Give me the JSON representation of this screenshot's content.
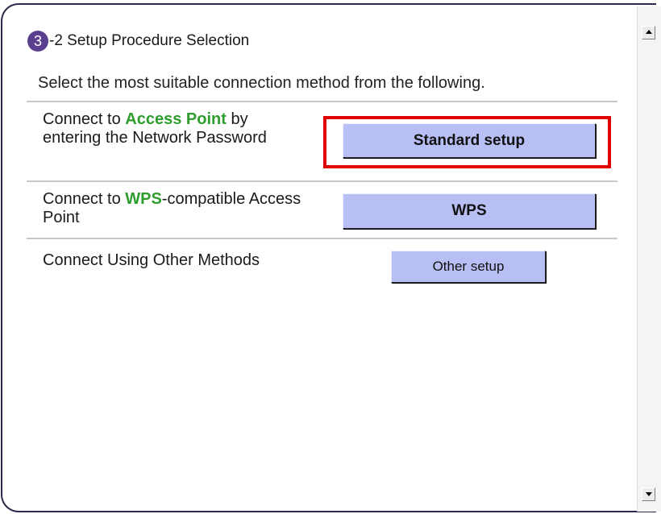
{
  "header": {
    "step_number": "3",
    "title": "-2 Setup Procedure Selection"
  },
  "instruction": "Select the most suitable connection method from the following.",
  "options": [
    {
      "label_pre": "Connect to ",
      "label_highlight": "Access Point",
      "label_post": " by entering the Network Password",
      "button": "Standard setup"
    },
    {
      "label_pre": "Connect to ",
      "label_highlight": "WPS",
      "label_post": "-compatible Access Point",
      "button": "WPS"
    },
    {
      "label_text": "Connect Using Other Methods",
      "button": "Other setup"
    }
  ],
  "colors": {
    "highlight_text": "#2e9d2e",
    "button_fill": "#b8bff5",
    "step_badge": "#5b3f8f",
    "callout_border": "#e00000"
  }
}
